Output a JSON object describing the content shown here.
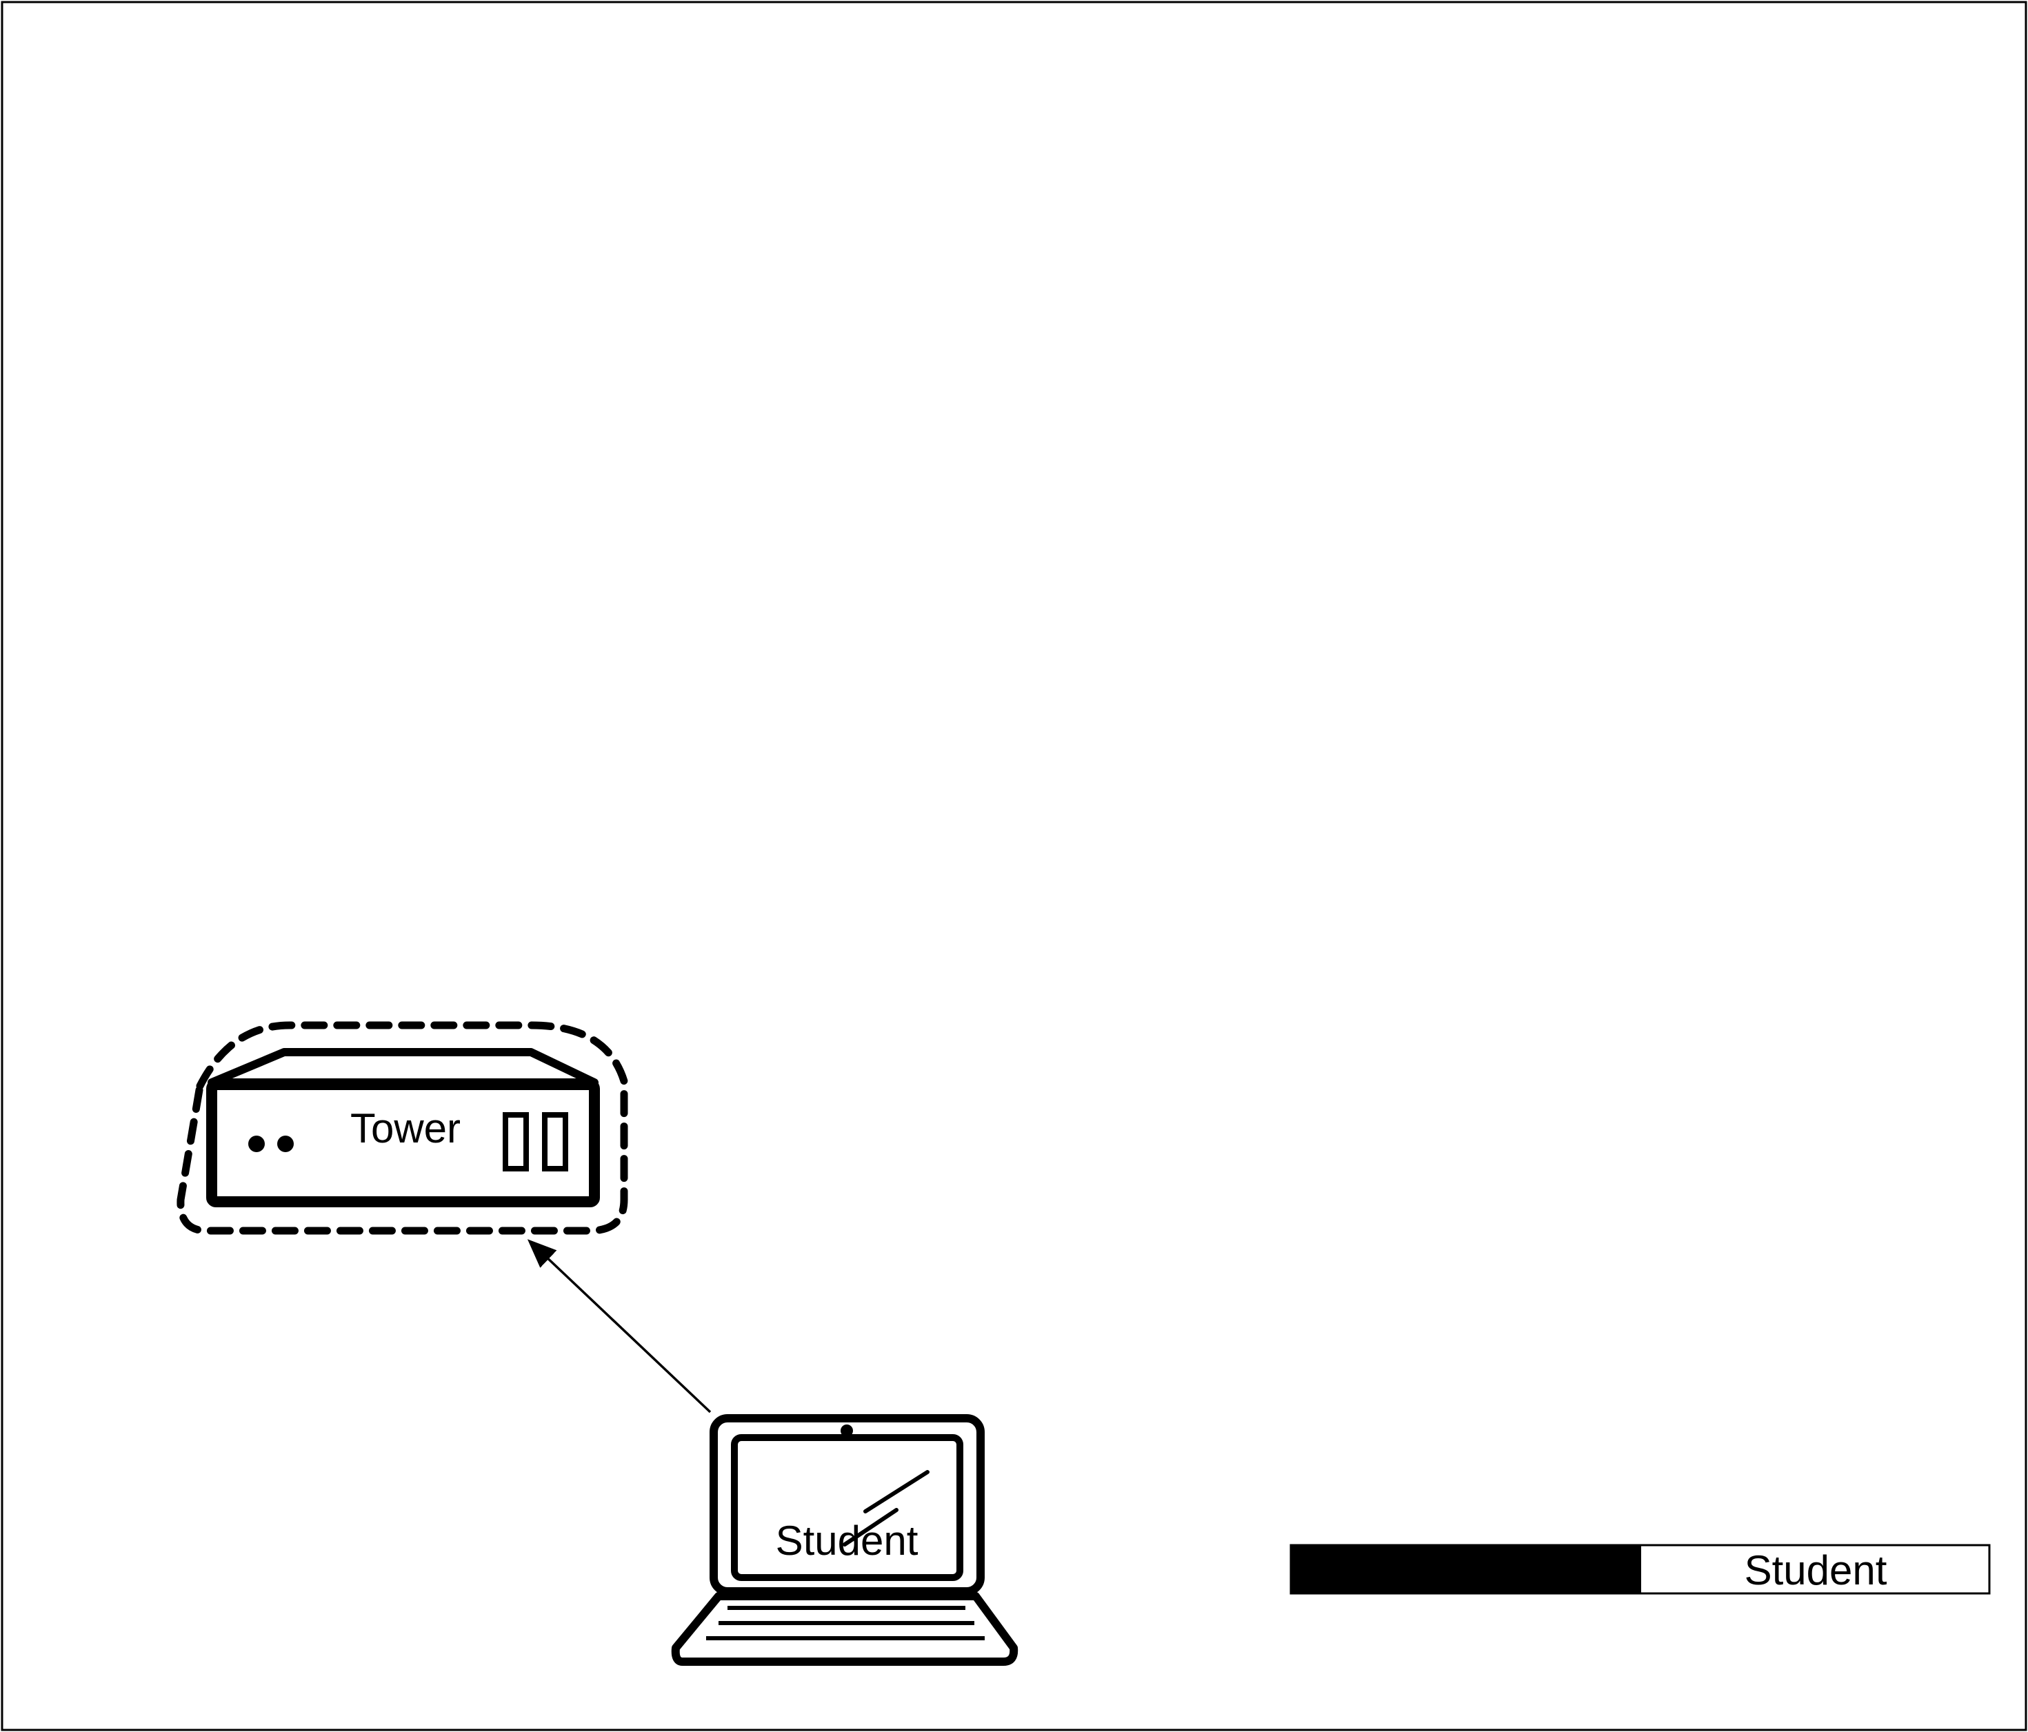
{
  "diagram": {
    "nodes": [
      {
        "id": "tower",
        "label": "Tower",
        "icon": "tower-server-icon",
        "highlighted": true
      },
      {
        "id": "student-laptop",
        "label": "Student",
        "icon": "laptop-icon"
      }
    ],
    "edges": [
      {
        "from": "student-laptop",
        "to": "tower",
        "style": "arrow"
      }
    ],
    "legend": {
      "label": "Student",
      "swatch_color": "#000000"
    }
  }
}
